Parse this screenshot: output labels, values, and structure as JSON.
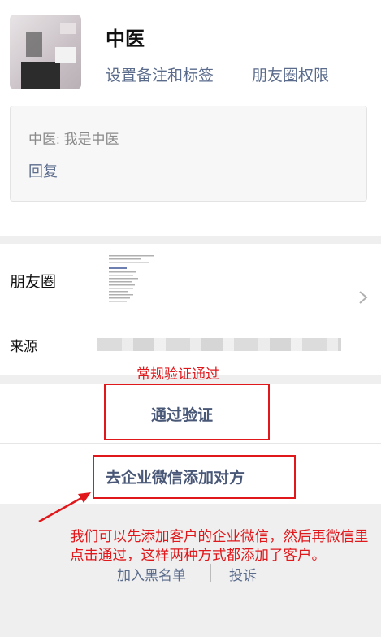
{
  "contact": {
    "name": "中医",
    "set_remark_tags": "设置备注和标签",
    "moments_permission": "朋友圈权限"
  },
  "request_card": {
    "message": "中医: 我是中医",
    "reply": "回复"
  },
  "rows": {
    "moments_label": "朋友圈",
    "source_label": "来源"
  },
  "actions": {
    "verify_button": "通过验证",
    "enterprise_button": "去企业微信添加对方",
    "blacklist": "加入黑名单",
    "report": "投诉"
  },
  "annotations": {
    "normal_verify": "常规验证通过",
    "note": "我们可以先添加客户的企业微信，然后再微信里点击通过，这样两种方式都添加了客户。"
  },
  "colors": {
    "link": "#5a6b8c",
    "annotation_red": "#e0181b",
    "background_gray": "#efefef"
  }
}
